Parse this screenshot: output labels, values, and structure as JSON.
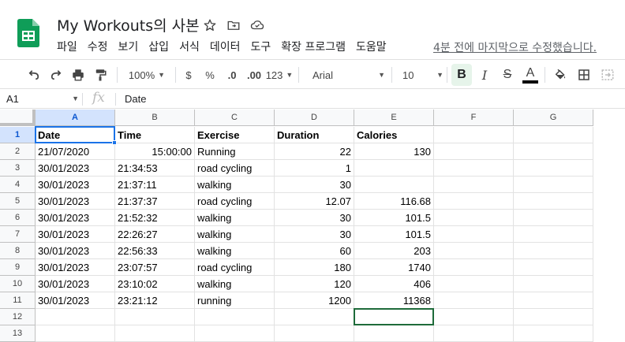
{
  "app": {
    "title": "My Workouts의 사본",
    "last_edit": "4분 전에 마지막으로 수정했습니다.",
    "menu": [
      "파일",
      "수정",
      "보기",
      "삽입",
      "서식",
      "데이터",
      "도구",
      "확장 프로그램",
      "도움말"
    ]
  },
  "toolbar": {
    "zoom": "100%",
    "currency": "$",
    "percent": "%",
    "dec_decrease": ".0",
    "dec_increase": ".00",
    "more_formats": "123",
    "font": "Arial",
    "font_size": "10",
    "bold": "B",
    "italic": "I",
    "strike": "S",
    "text_color": "A"
  },
  "formula_bar": {
    "name_box": "A1",
    "fx": "fx",
    "content": "Date"
  },
  "columns": [
    "A",
    "B",
    "C",
    "D",
    "E",
    "F",
    "G"
  ],
  "rows": [
    "1",
    "2",
    "3",
    "4",
    "5",
    "6",
    "7",
    "8",
    "9",
    "10",
    "11",
    "12",
    "13"
  ],
  "table": {
    "header": [
      "Date",
      "Time",
      "Exercise",
      "Duration",
      "Calories"
    ],
    "rows": [
      [
        "21/07/2020",
        "15:00:00",
        "Running",
        "22",
        "130"
      ],
      [
        "30/01/2023",
        "21:34:53",
        "road cycling",
        "1",
        ""
      ],
      [
        "30/01/2023",
        "21:37:11",
        "walking",
        "30",
        ""
      ],
      [
        "30/01/2023",
        "21:37:37",
        "road cycling",
        "12.07",
        "116.68"
      ],
      [
        "30/01/2023",
        "21:52:32",
        "walking",
        "30",
        "101.5"
      ],
      [
        "30/01/2023",
        "22:26:27",
        "walking",
        "30",
        "101.5"
      ],
      [
        "30/01/2023",
        "22:56:33",
        "walking",
        "60",
        "203"
      ],
      [
        "30/01/2023",
        "23:07:57",
        "road cycling",
        "180",
        "1740"
      ],
      [
        "30/01/2023",
        "23:10:02",
        "walking",
        "120",
        "406"
      ],
      [
        "30/01/2023",
        "23:21:12",
        "running",
        "1200",
        "11368"
      ]
    ]
  },
  "colors": {
    "selection": "#1a73e8",
    "active_cell_e12": "#1e6b3a",
    "sheets_green": "#0f9d58"
  }
}
